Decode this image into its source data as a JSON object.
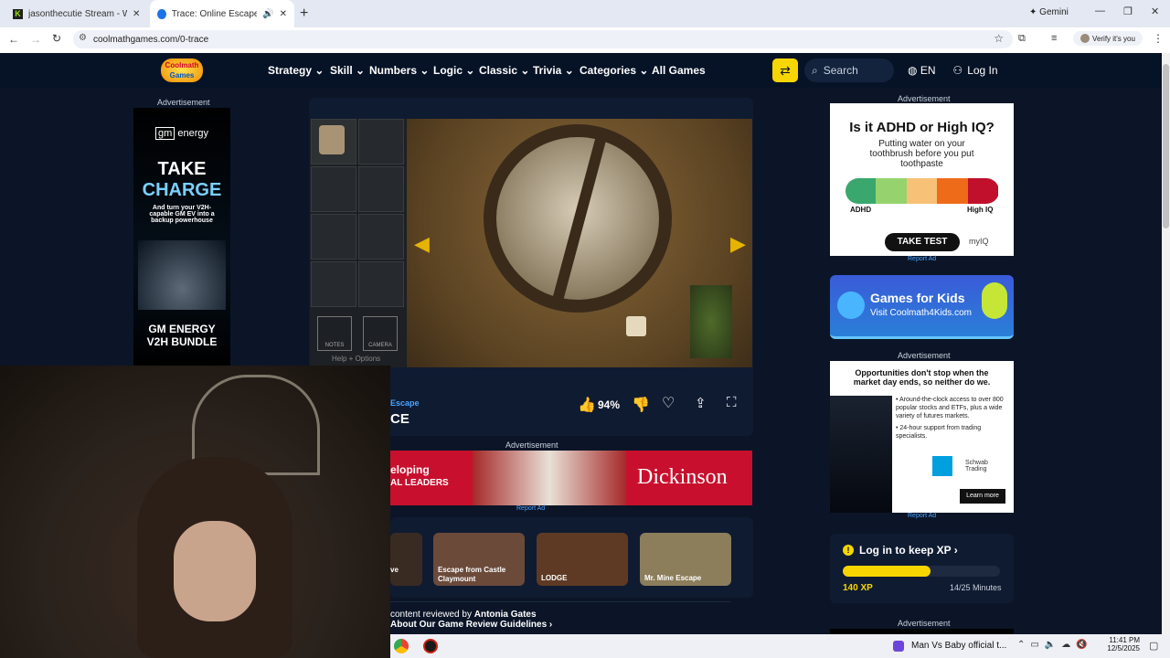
{
  "browser": {
    "tabs": [
      {
        "title": "jasonthecutie Stream - Watch L"
      },
      {
        "title": "Trace: Online Escape Room"
      }
    ],
    "new_tab": "+",
    "gemini": "Gemini",
    "url": "coolmathgames.com/0-trace",
    "verify": "Verify it's you"
  },
  "site": {
    "logo_top": "Coolmath",
    "logo_bottom": "Games",
    "menu": [
      "Strategy",
      "Skill",
      "Numbers",
      "Logic",
      "Classic",
      "Trivia",
      "Categories",
      "All Games"
    ],
    "search_placeholder": "Search",
    "lang": "EN",
    "login": "Log In"
  },
  "game": {
    "help": "Help + Options",
    "category": "Escape",
    "title_fragment": "CE",
    "rating": "94%",
    "notes": "NOTES",
    "camera": "CAMERA"
  },
  "ads": {
    "advertisement": "Advertisement",
    "report": "Report Ad",
    "left": {
      "brand": "energy",
      "line1": "TAKE",
      "line2": "CHARGE",
      "body": "And turn your V2H-capable GM EV into a backup powerhouse",
      "footer1": "GM ENERGY",
      "footer2": "V2H BUNDLE"
    },
    "iq": {
      "title": "Is it ADHD or High IQ?",
      "sub": "Putting water on your toothbrush before you put toothpaste",
      "left": "ADHD",
      "right": "High IQ",
      "cta": "TAKE TEST",
      "brand": "myIQ"
    },
    "kids": {
      "title": "Games for Kids",
      "sub": "Visit Coolmath4Kids.com"
    },
    "schwab": {
      "title": "Opportunities don't stop when the market day ends, so neither do we.",
      "b1": "Around-the-clock access to over 800 popular stocks and ETFs, plus a wide variety of futures markets.",
      "b2": "24-hour support from trading specialists.",
      "brand": "Schwab Trading",
      "cta": "Learn more"
    },
    "mid": {
      "left": "eloping",
      "left2": "AL LEADERS",
      "brand": "Dickinson"
    }
  },
  "related": [
    {
      "title": "ve"
    },
    {
      "title": "Escape from Castle Claymount"
    },
    {
      "title": "LODGE"
    },
    {
      "title": "Mr. Mine Escape"
    }
  ],
  "review": {
    "prefix": "content reviewed by",
    "author": "Antonia Gates",
    "link": "About Our Game Review Guidelines"
  },
  "xp": {
    "title": "Log in to keep XP",
    "xp": "140 XP",
    "minutes": "14/25 Minutes",
    "progress": 0.56
  },
  "taskbar": {
    "media": "Man Vs Baby official t...",
    "time": "11:41 PM",
    "date": "12/5/2025"
  },
  "colors": {
    "accent": "#f7d600",
    "nav_bg": "#061226",
    "page_bg": "#0b1527"
  }
}
